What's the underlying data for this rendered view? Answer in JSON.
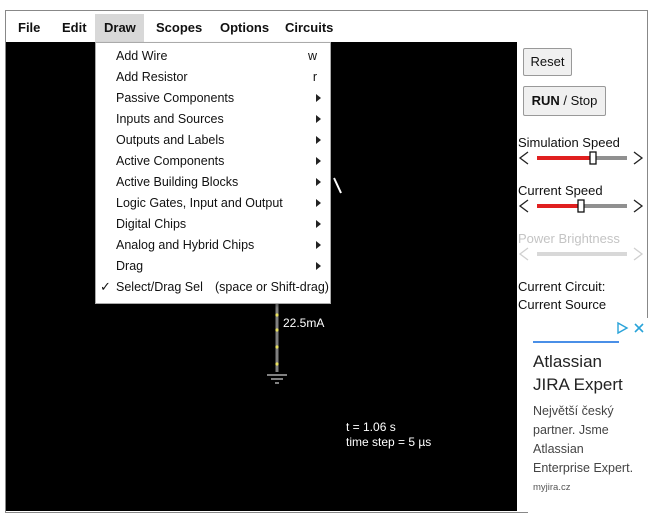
{
  "menubar": {
    "items": [
      "File",
      "Edit",
      "Draw",
      "Scopes",
      "Options",
      "Circuits"
    ],
    "active": "Draw"
  },
  "draw_menu": {
    "items": [
      {
        "label": "Add Wire",
        "shortcut": "w"
      },
      {
        "label": "Add Resistor",
        "shortcut": "r"
      },
      {
        "label": "Passive Components",
        "submenu": true
      },
      {
        "label": "Inputs and Sources",
        "submenu": true
      },
      {
        "label": "Outputs and Labels",
        "submenu": true
      },
      {
        "label": "Active Components",
        "submenu": true
      },
      {
        "label": "Active Building Blocks",
        "submenu": true
      },
      {
        "label": "Logic Gates, Input and Output",
        "submenu": true
      },
      {
        "label": "Digital Chips",
        "submenu": true
      },
      {
        "label": "Analog and Hybrid Chips",
        "submenu": true
      },
      {
        "label": "Drag",
        "submenu": true
      },
      {
        "label": "Select/Drag Sel",
        "shortcut_long": "(space or Shift-drag)",
        "checked": true
      }
    ],
    "check_glyph": "✓"
  },
  "canvas": {
    "current_label": "22.5mA",
    "time_label": "t = 1.06 s",
    "timestep_label": "time step = 5 µs"
  },
  "sidebar": {
    "reset_label": "Reset",
    "run_label": "RUN",
    "stop_label": " / Stop",
    "sim_speed_label": "Simulation Speed",
    "sim_speed_value": 0.62,
    "current_speed_label": "Current Speed",
    "current_speed_value": 0.49,
    "power_brightness_label": "Power Brightness",
    "current_circuit_label": "Current Circuit:",
    "current_circuit_name": "Current Source"
  },
  "ad": {
    "title_line1": "Atlassian",
    "title_line2": "JIRA Expert",
    "body": [
      "Největší český",
      "partner. Jsme",
      "Atlassian",
      "Enterprise Expert."
    ],
    "domain": "myjira.cz",
    "adchoices_icon": "adchoices-icon",
    "close_icon": "close-icon",
    "accent_color": "#4a8fe7"
  },
  "colors": {
    "canvas_bg": "#000000",
    "slider_fill": "#e02020",
    "slider_track": "#909090",
    "wire": "#808080",
    "wire_dot": "#e8e060"
  }
}
